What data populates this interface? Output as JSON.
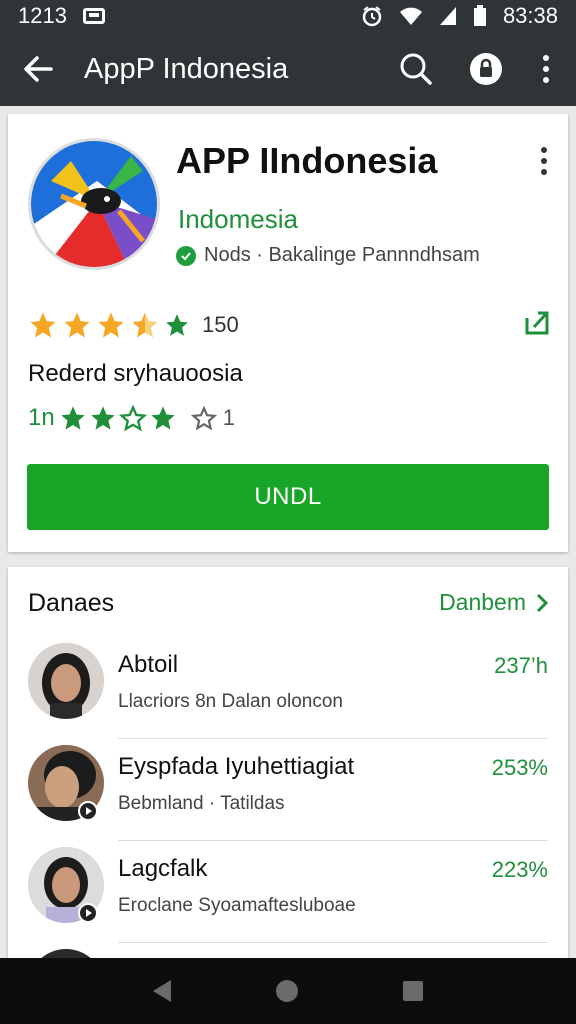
{
  "status_bar": {
    "left_time": "1213",
    "right_time": "83:38",
    "icons": [
      "notification-icon",
      "alarm-icon",
      "wifi-icon",
      "signal-icon",
      "battery-icon"
    ]
  },
  "toolbar": {
    "title": "AppP Indonesia",
    "icons": [
      "back-arrow-icon",
      "search-icon",
      "lock-icon",
      "more-vert-icon"
    ]
  },
  "app": {
    "name": "APP IIndonesia",
    "developer": "Indomesia",
    "verified_text": "Nods · Bakalinge Pannndhsam",
    "rating_stars": 4.5,
    "rating_count": "150",
    "rated_label": "Rederd sryhauoosia",
    "rated_prefix": "1n",
    "rated_suffix": "1",
    "install_label": "UNDL",
    "colors": {
      "accent": "#19a628",
      "dark": "#2f3437"
    }
  },
  "list": {
    "header": "Danaes",
    "more_label": "Danbem",
    "items": [
      {
        "name": "Abtoil",
        "subtitle": "Llacriors 8n Dalan oloncon",
        "price": "237’h",
        "has_play": false
      },
      {
        "name": "Eyspfada Iyuhettiagiat",
        "subtitle": "Bebmland · Tatildas",
        "price": "253%",
        "has_play": true
      },
      {
        "name": "Lagcfalk",
        "subtitle": "Eroclane Syoamaftesluboae",
        "price": "223%",
        "has_play": true
      }
    ]
  }
}
